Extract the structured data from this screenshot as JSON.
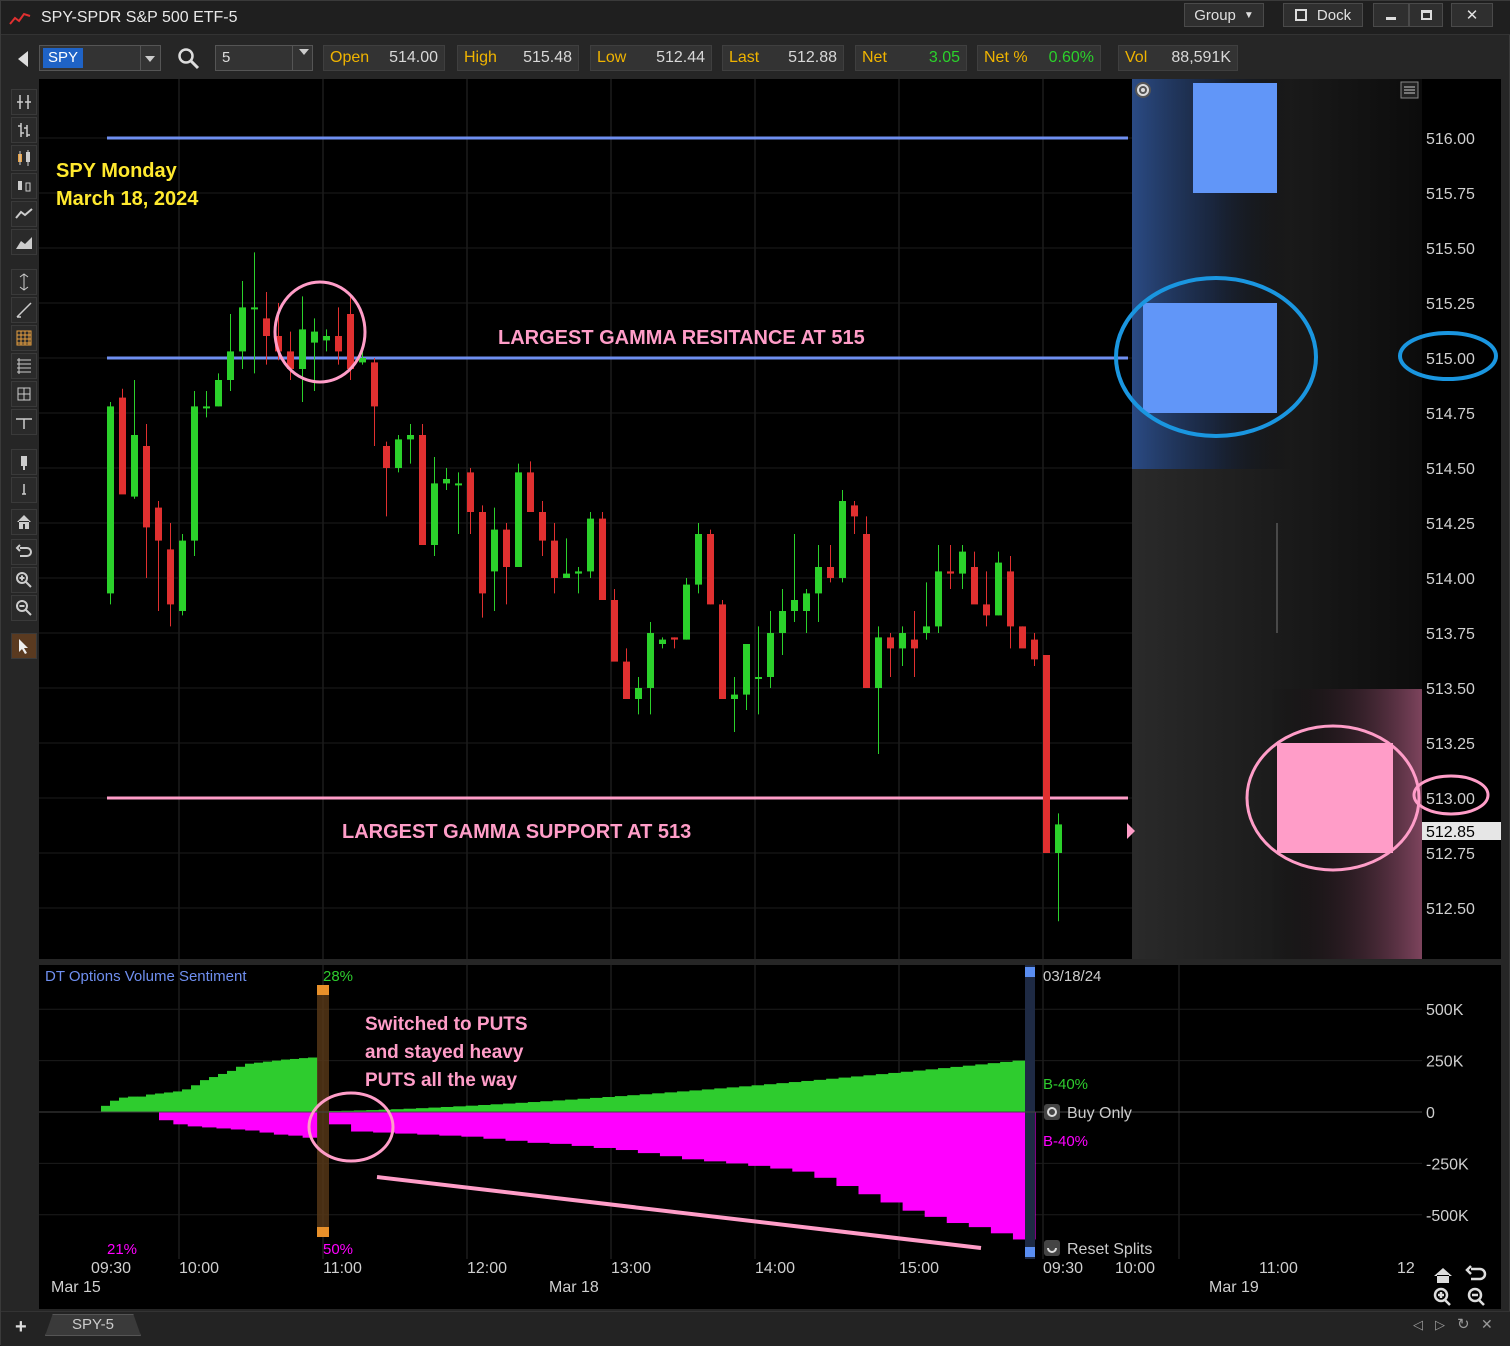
{
  "window": {
    "title": "SPY-SPDR S&P 500 ETF-5",
    "group_label": "Group",
    "dock_label": "Dock"
  },
  "quote": {
    "symbol": "SPY",
    "interval": "5",
    "open_label": "Open",
    "open": "514.00",
    "high_label": "High",
    "high": "515.48",
    "low_label": "Low",
    "low": "512.44",
    "last_label": "Last",
    "last": "512.88",
    "net_label": "Net",
    "net": "3.05",
    "netpct_label": "Net %",
    "netpct": "0.60%",
    "vol_label": "Vol",
    "vol": "88,591K"
  },
  "colors": {
    "up": "#2bd12b",
    "down": "#e03030",
    "resistance": "#6f8ff0",
    "support": "#ff9dc8",
    "annotation": "#ffe92e",
    "call_area": "#2ecc2e",
    "put_area": "#ff00ff",
    "circle_pink": "#ff9dc8",
    "circle_blue": "#1a96e0"
  },
  "annotations": {
    "day_title_1": "SPY Monday",
    "day_title_2": "March 18, 2024",
    "resistance_text": "LARGEST GAMMA RESITANCE AT 515",
    "support_text": "LARGEST GAMMA SUPPORT AT 513",
    "puts_line1": "Switched to PUTS",
    "puts_line2": "and stayed heavy",
    "puts_line3": "PUTS all the way"
  },
  "price_axis": {
    "ticks": [
      "516.00",
      "515.75",
      "515.50",
      "515.25",
      "515.00",
      "514.75",
      "514.50",
      "514.25",
      "514.00",
      "513.75",
      "513.50",
      "513.25",
      "513.00",
      "512.75",
      "512.50"
    ],
    "last_marker": "512.85"
  },
  "indicator": {
    "name": "DT Options Volume Sentiment",
    "top_pct": "28%",
    "left_pct": "21%",
    "bottom_pct": "50%",
    "date": "03/18/24",
    "call_label": "B-40%",
    "put_label": "B-40%",
    "buy_only": "Buy Only",
    "reset_splits": "Reset Splits",
    "ticks": [
      "500K",
      "250K",
      "0",
      "-250K",
      "-500K"
    ]
  },
  "time_axis": {
    "times": [
      "09:30",
      "10:00",
      "11:00",
      "12:00",
      "13:00",
      "14:00",
      "15:00",
      "09:30",
      "10:00",
      "11:00",
      "12"
    ],
    "dates": [
      "Mar 15",
      "Mar 18",
      "Mar 19"
    ]
  },
  "bottom": {
    "tab": "SPY-5"
  },
  "chart_data": {
    "type": "candlestick",
    "title": "SPY Monday March 18, 2024",
    "ylim": [
      512.3,
      516.25
    ],
    "levels": [
      {
        "price": 516.0,
        "color": "resistance"
      },
      {
        "price": 515.0,
        "color": "resistance"
      },
      {
        "price": 513.0,
        "color": "support"
      }
    ],
    "candles": [
      [
        513.93,
        514.8,
        513.88,
        514.78
      ],
      [
        514.82,
        514.86,
        514.39,
        514.38
      ],
      [
        514.37,
        514.9,
        514.36,
        514.65
      ],
      [
        514.6,
        514.7,
        514.0,
        514.23
      ],
      [
        514.32,
        514.35,
        513.85,
        514.17
      ],
      [
        514.13,
        514.25,
        513.78,
        513.88
      ],
      [
        513.85,
        514.2,
        513.83,
        514.17
      ],
      [
        514.17,
        514.85,
        514.1,
        514.78
      ],
      [
        514.78,
        514.85,
        514.73,
        514.78
      ],
      [
        514.78,
        514.93,
        514.78,
        514.9
      ],
      [
        514.9,
        515.2,
        514.85,
        515.03
      ],
      [
        515.03,
        515.35,
        514.95,
        515.23
      ],
      [
        515.23,
        515.48,
        514.93,
        515.23
      ],
      [
        515.18,
        515.3,
        514.97,
        515.1
      ],
      [
        515.1,
        515.25,
        514.99,
        515.03
      ],
      [
        515.03,
        515.12,
        514.9,
        514.95
      ],
      [
        514.95,
        515.28,
        514.8,
        515.13
      ],
      [
        515.07,
        515.18,
        514.85,
        515.12
      ],
      [
        515.08,
        515.13,
        515.03,
        515.1
      ],
      [
        515.1,
        515.23,
        514.97,
        515.03
      ],
      [
        515.2,
        515.28,
        514.9,
        514.95
      ],
      [
        514.98,
        515.06,
        514.97,
        515.0
      ],
      [
        514.98,
        515.0,
        514.6,
        514.78
      ],
      [
        514.6,
        514.62,
        514.28,
        514.5
      ],
      [
        514.5,
        514.65,
        514.48,
        514.63
      ],
      [
        514.63,
        514.7,
        514.52,
        514.65
      ],
      [
        514.65,
        514.7,
        514.3,
        514.15
      ],
      [
        514.15,
        514.55,
        514.1,
        514.43
      ],
      [
        514.43,
        514.5,
        514.4,
        514.45
      ],
      [
        514.43,
        514.48,
        514.2,
        514.43
      ],
      [
        514.48,
        514.5,
        514.2,
        514.3
      ],
      [
        514.3,
        514.33,
        513.82,
        513.93
      ],
      [
        514.03,
        514.32,
        513.85,
        514.22
      ],
      [
        514.22,
        514.25,
        513.88,
        514.05
      ],
      [
        514.05,
        514.52,
        514.1,
        514.48
      ],
      [
        514.48,
        514.53,
        514.35,
        514.3
      ],
      [
        514.3,
        514.35,
        514.1,
        514.17
      ],
      [
        514.17,
        514.25,
        513.93,
        514.0
      ],
      [
        514.0,
        514.18,
        514.0,
        514.02
      ],
      [
        514.02,
        514.05,
        513.93,
        514.03
      ],
      [
        514.03,
        514.3,
        514.0,
        514.27
      ],
      [
        514.27,
        514.3,
        514.0,
        513.9
      ],
      [
        513.9,
        513.95,
        513.63,
        513.62
      ],
      [
        513.62,
        513.68,
        513.48,
        513.45
      ],
      [
        513.45,
        513.55,
        513.38,
        513.5
      ],
      [
        513.5,
        513.8,
        513.38,
        513.75
      ],
      [
        513.7,
        513.73,
        513.68,
        513.72
      ],
      [
        513.73,
        513.73,
        513.68,
        513.72
      ],
      [
        513.72,
        514.0,
        513.72,
        513.97
      ],
      [
        513.97,
        514.25,
        513.93,
        514.2
      ],
      [
        514.2,
        514.22,
        513.88,
        513.88
      ],
      [
        513.88,
        513.9,
        513.5,
        513.45
      ],
      [
        513.45,
        513.55,
        513.3,
        513.47
      ],
      [
        513.47,
        513.7,
        513.4,
        513.7
      ],
      [
        513.55,
        513.78,
        513.38,
        513.55
      ],
      [
        513.55,
        513.85,
        513.5,
        513.75
      ],
      [
        513.75,
        513.95,
        513.65,
        513.85
      ],
      [
        513.85,
        514.2,
        513.8,
        513.9
      ],
      [
        513.85,
        513.95,
        513.75,
        513.93
      ],
      [
        513.93,
        514.15,
        513.8,
        514.05
      ],
      [
        514.05,
        514.15,
        513.98,
        514.0
      ],
      [
        514.0,
        514.4,
        513.98,
        514.35
      ],
      [
        514.33,
        514.35,
        514.2,
        514.28
      ],
      [
        514.2,
        514.28,
        513.85,
        513.5
      ],
      [
        513.5,
        513.78,
        513.2,
        513.73
      ],
      [
        513.73,
        513.75,
        513.55,
        513.68
      ],
      [
        513.68,
        513.78,
        513.6,
        513.75
      ],
      [
        513.72,
        513.85,
        513.55,
        513.68
      ],
      [
        513.75,
        513.98,
        513.72,
        513.78
      ],
      [
        513.78,
        514.15,
        513.75,
        514.03
      ],
      [
        514.03,
        514.15,
        513.95,
        514.02
      ],
      [
        514.02,
        514.15,
        513.95,
        514.12
      ],
      [
        514.05,
        514.12,
        513.9,
        513.88
      ],
      [
        513.88,
        514.03,
        513.78,
        513.83
      ],
      [
        513.83,
        514.12,
        513.83,
        514.07
      ],
      [
        514.03,
        514.1,
        513.68,
        513.78
      ],
      [
        513.78,
        513.78,
        513.72,
        513.68
      ],
      [
        513.72,
        513.75,
        513.6,
        513.63
      ],
      [
        513.65,
        513.65,
        513.2,
        512.75
      ],
      [
        512.75,
        512.93,
        512.44,
        512.88
      ]
    ]
  },
  "options_volume": {
    "calls_k": [
      30,
      55,
      70,
      75,
      75,
      85,
      90,
      95,
      100,
      110,
      130,
      155,
      170,
      185,
      200,
      220,
      235,
      240,
      245,
      250,
      255,
      258,
      262,
      265
    ],
    "puts_k": [
      -60,
      -95,
      -100,
      -105,
      -110,
      -115,
      -120,
      -130,
      -140,
      -150,
      -155,
      -165,
      -175,
      -185,
      -200,
      -215,
      -230,
      -240,
      -250,
      -262,
      -275,
      -290,
      -320,
      -360,
      -400,
      -440,
      -480,
      -510,
      -540,
      -560,
      -590,
      -620
    ],
    "gap_after_index": 23
  }
}
